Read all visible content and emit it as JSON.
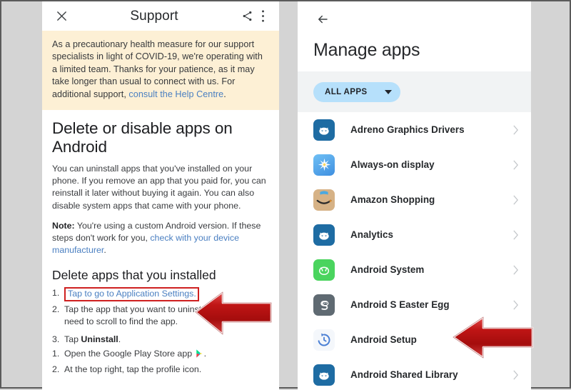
{
  "left_panel": {
    "appbar": {
      "close_icon": "close-icon",
      "title": "Support",
      "share_icon": "share-icon",
      "overflow_icon": "more-vert-icon"
    },
    "banner": {
      "text_before_link": "As a precautionary health measure for our support specialists in light of COVID-19, we're operating with a limited team. Thanks for your patience, as it may take longer than usual to connect with us. For additional support, ",
      "link_text": "consult the Help Centre",
      "text_after_link": ".",
      "bg_color": "#fdf0d5"
    },
    "article": {
      "title": "Delete or disable apps on Android",
      "paragraph_1": "You can uninstall apps that you've installed on your phone. If you remove an app that you paid for, you can reinstall it later without buying it again. You can also disable system apps that came with your phone.",
      "note_label": "Note:",
      "note_text_before_link": " You're using a custom Android version. If these steps don't work for you, ",
      "note_link_text": "check with your device manufacturer",
      "note_text_after_link": ".",
      "section_title": "Delete apps that you installed",
      "steps": [
        {
          "num": "1.",
          "text": "Tap to go to Application Settings.",
          "is_link": true,
          "highlighted": true
        },
        {
          "num": "2.",
          "text": "Tap the app that you want to uninstall. You may need to scroll to find the app.",
          "is_link": false,
          "highlighted": false
        },
        {
          "num": "3.",
          "text_before_bold": "Tap ",
          "bold_text": "Uninstall",
          "text_after_bold": ".",
          "is_link": false,
          "highlighted": false
        }
      ],
      "steps_second_list": [
        {
          "num": "1.",
          "text": "Open the Google Play Store app",
          "has_playstore_icon": true,
          "suffix": "."
        },
        {
          "num": "2.",
          "text": "At the top right, tap the profile icon.",
          "has_playstore_icon": false,
          "suffix": ""
        }
      ]
    }
  },
  "right_panel": {
    "back_icon": "back-arrow-icon",
    "title": "Manage apps",
    "filter_chip": {
      "label": "ALL APPS",
      "caret_icon": "chevron-down-icon",
      "bg_color": "#b6e0fb"
    },
    "apps": [
      {
        "name": "Adreno Graphics Drivers",
        "icon": "android-head-icon",
        "icon_bg": "#1e6ca3",
        "chevron": "chevron-right-icon"
      },
      {
        "name": "Always-on display",
        "icon": "starburst-icon",
        "icon_bg": "#56a8ee",
        "chevron": "chevron-right-icon"
      },
      {
        "name": "Amazon Shopping",
        "icon": "amazon-smile-icon",
        "icon_bg": "#d6b286",
        "chevron": "chevron-right-icon"
      },
      {
        "name": "Analytics",
        "icon": "android-head-icon",
        "icon_bg": "#1e6ca3",
        "chevron": "chevron-right-icon"
      },
      {
        "name": "Android System",
        "icon": "android-head-icon",
        "icon_bg": "#4ad45e",
        "chevron": "chevron-right-icon"
      },
      {
        "name": "Android S Easter Egg",
        "icon": "android-s-icon",
        "icon_bg": "#5f6a72",
        "chevron": "chevron-right-icon"
      },
      {
        "name": "Android Setup",
        "icon": "history-clock-icon",
        "icon_bg": "#f4f7fb",
        "chevron": "chevron-right-icon"
      },
      {
        "name": "Android Shared Library",
        "icon": "android-head-icon",
        "icon_bg": "#1e6ca3",
        "chevron": "chevron-right-icon"
      }
    ]
  },
  "annotations": {
    "arrow_color": "#c01515",
    "arrow_left": {
      "label": "red-arrow-pointing-to-application-settings-link"
    },
    "arrow_right": {
      "label": "red-arrow-pointing-to-android-setup-row"
    },
    "highlight_box_color": "#cf2020"
  },
  "page": {
    "background_color": "#d4d4d4",
    "border_color": "#5b5b5b"
  }
}
